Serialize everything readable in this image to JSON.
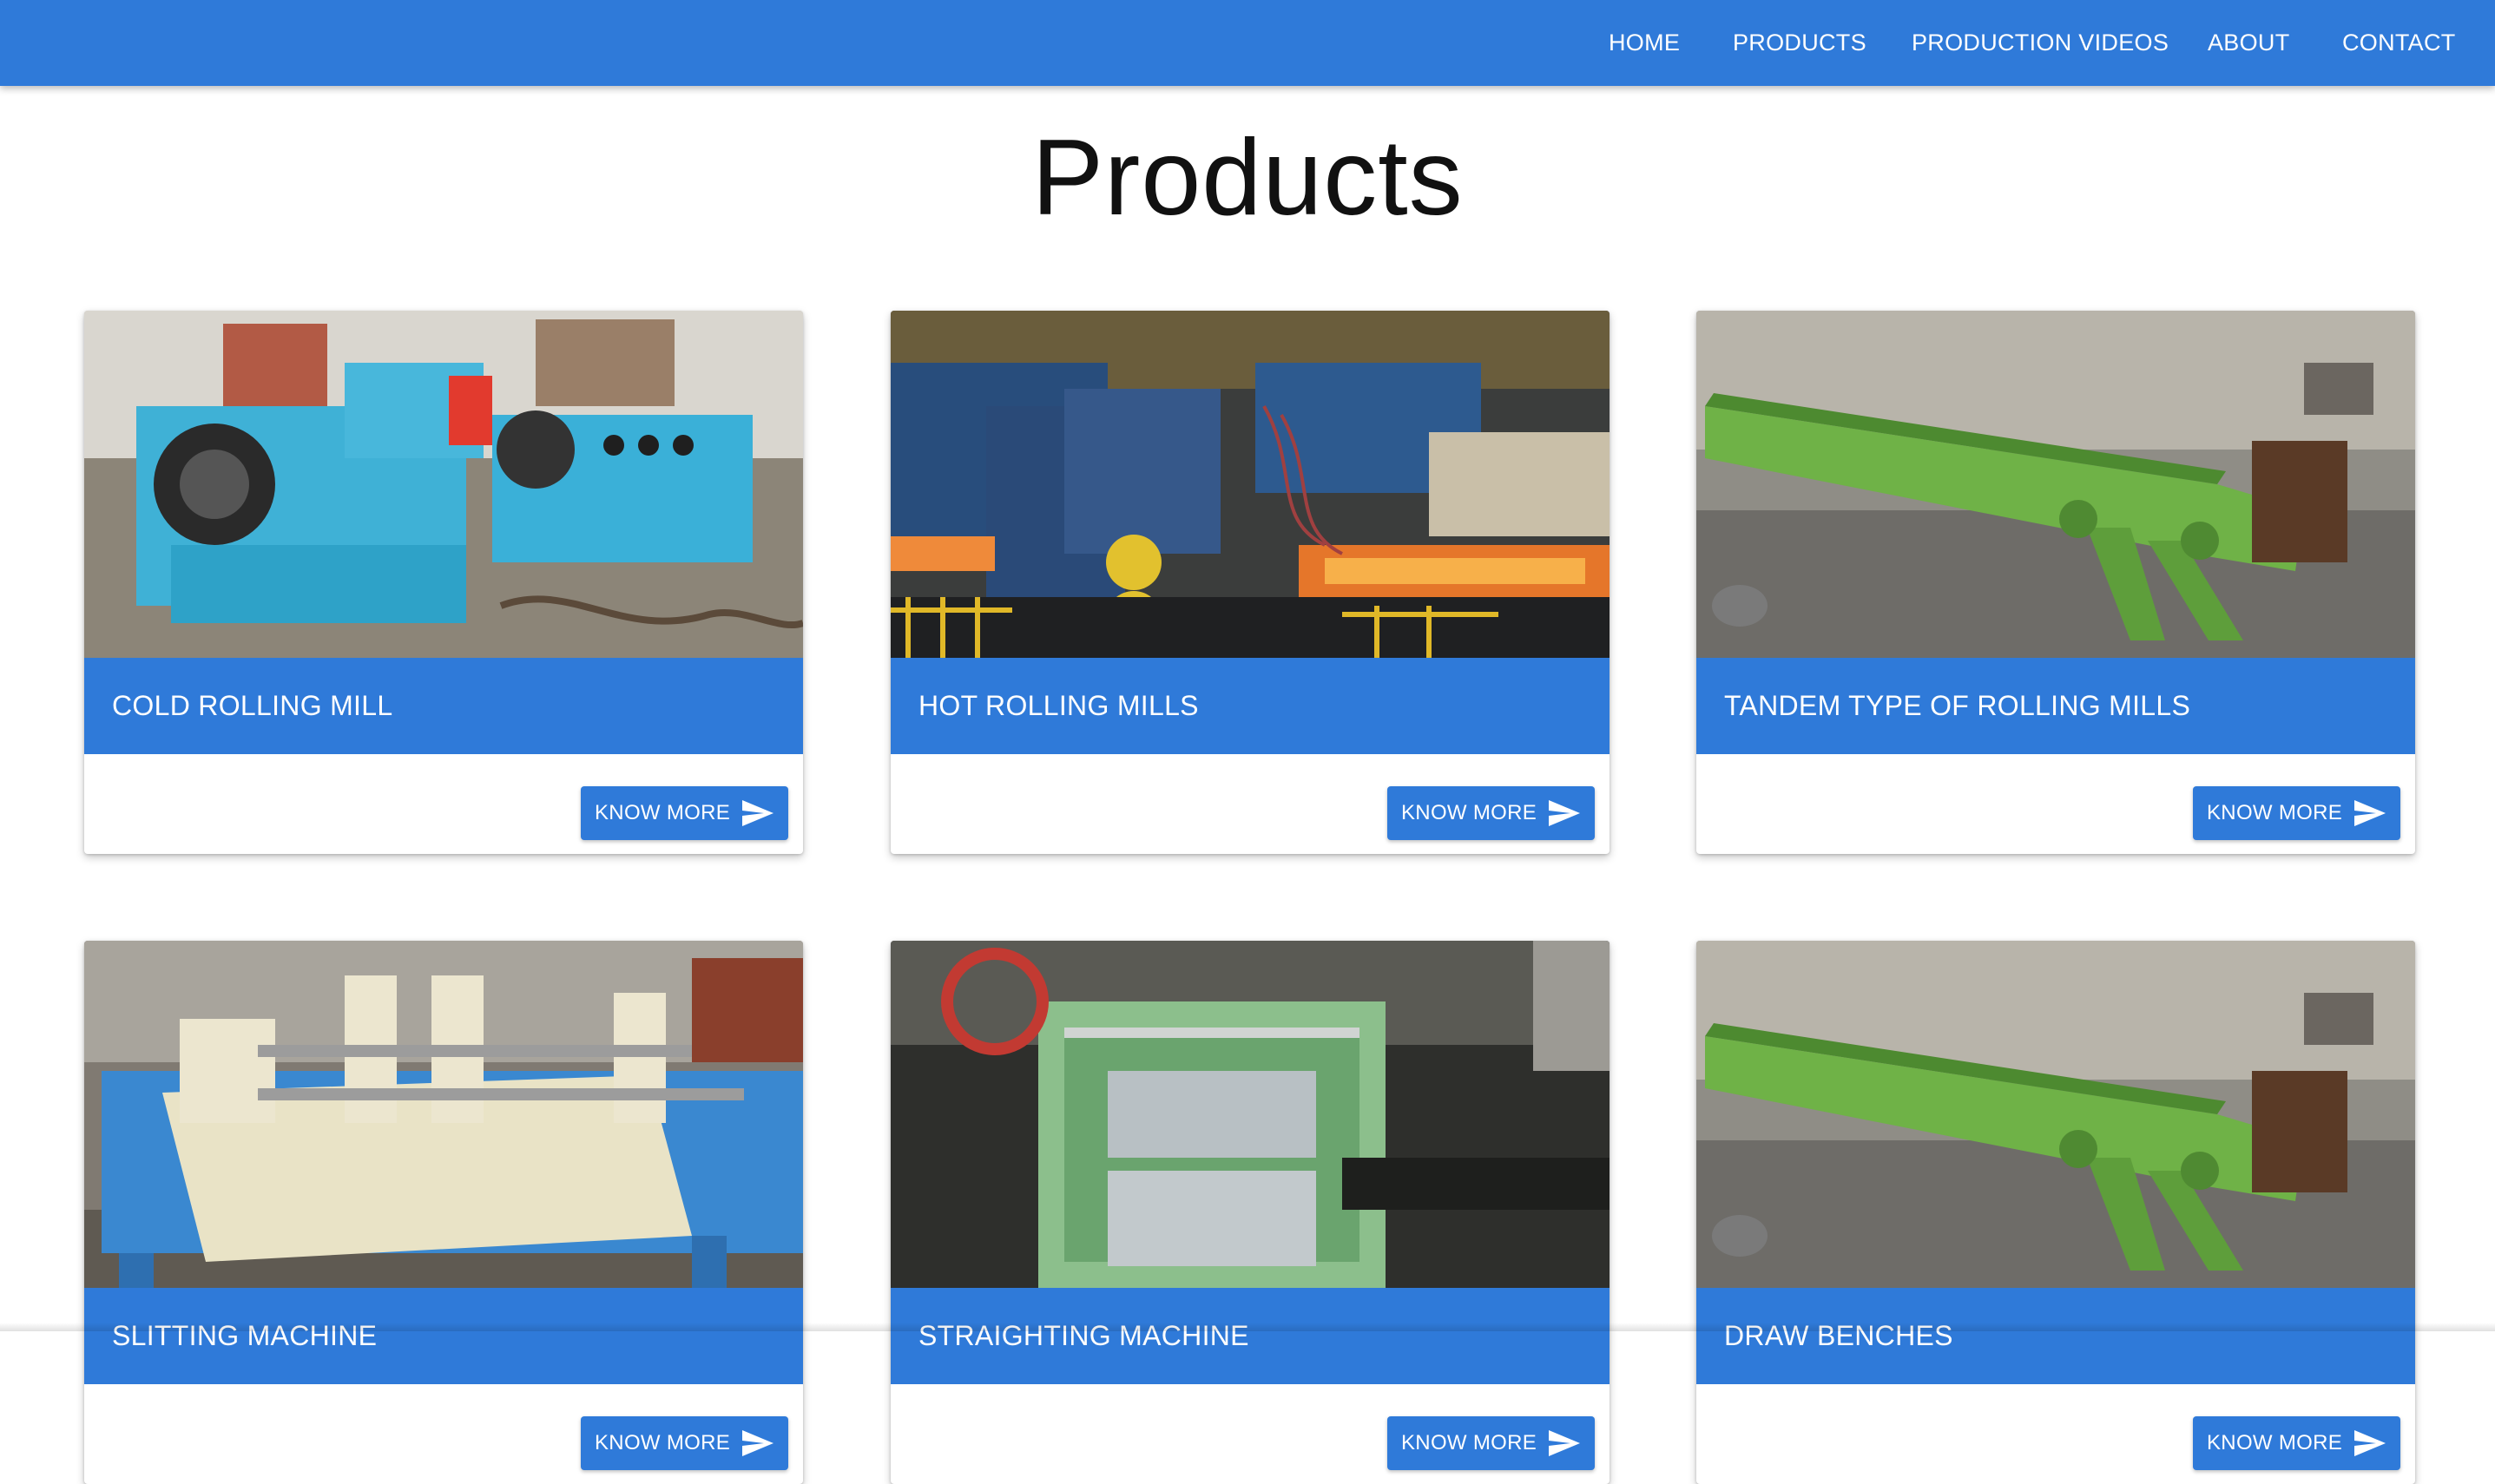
{
  "nav": {
    "items": [
      {
        "label": "HOME"
      },
      {
        "label": "PRODUCTS"
      },
      {
        "label": "PRODUCTION VIDEOS"
      },
      {
        "label": "ABOUT"
      },
      {
        "label": "CONTACT"
      }
    ]
  },
  "page": {
    "title": "Products"
  },
  "products": [
    {
      "title": "COLD ROLLING MILL",
      "button_label": "KNOW MORE",
      "image_icon": "machine-photo"
    },
    {
      "title": "HOT ROLLING MILLS",
      "button_label": "KNOW MORE",
      "image_icon": "machine-photo"
    },
    {
      "title": "TANDEM TYPE OF ROLLING MILLS",
      "button_label": "KNOW MORE",
      "image_icon": "machine-photo"
    },
    {
      "title": "SLITTING MACHINE",
      "button_label": "KNOW MORE",
      "image_icon": "machine-photo"
    },
    {
      "title": "STRAIGHTING MACHINE",
      "button_label": "KNOW MORE",
      "image_icon": "machine-photo"
    },
    {
      "title": "DRAW BENCHES",
      "button_label": "KNOW MORE",
      "image_icon": "machine-photo"
    }
  ],
  "colors": {
    "primary": "#2f7ad9",
    "text_on_primary": "#ffffff",
    "background": "#ffffff"
  }
}
